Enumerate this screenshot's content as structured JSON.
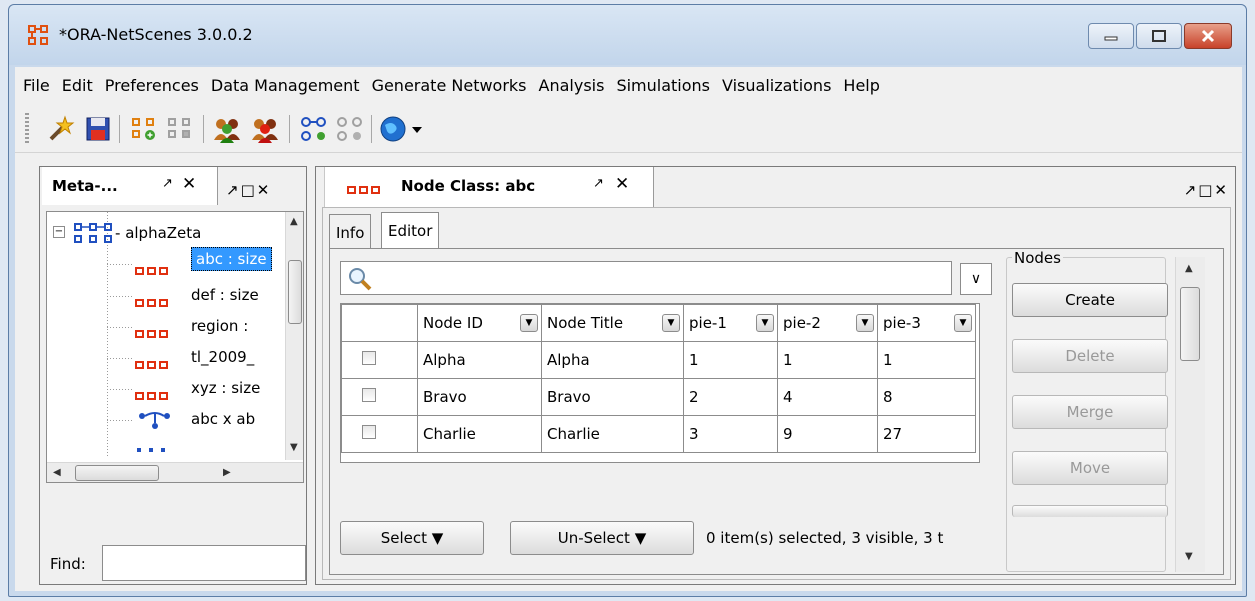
{
  "window": {
    "title": "*ORA-NetScenes 3.0.0.2",
    "controls": {
      "minimize": "minimize",
      "maximize": "maximize",
      "close": "close"
    }
  },
  "menu": {
    "items": [
      "File",
      "Edit",
      "Preferences",
      "Data Management",
      "Generate Networks",
      "Analysis",
      "Simulations",
      "Visualizations",
      "Help"
    ]
  },
  "toolbar": {
    "icons": [
      "wand-icon",
      "save-icon",
      "node-class-icon",
      "node-class-disabled-icon",
      "agents-icon",
      "agents-red-icon",
      "network-icon",
      "network-disabled-icon",
      "globe-icon"
    ]
  },
  "left_panel": {
    "tab_title": "Meta-...",
    "tree": {
      "root": "alphaZeta",
      "items": [
        {
          "label": "abc : size",
          "selected": true
        },
        {
          "label": "def : size"
        },
        {
          "label": "region : "
        },
        {
          "label": "tl_2009_"
        },
        {
          "label": "xyz : size"
        },
        {
          "label": "abc x ab"
        }
      ]
    },
    "find_label": "Find:",
    "find_value": ""
  },
  "right_panel": {
    "tab_title": "Node Class: abc",
    "sub_tabs": [
      "Info",
      "Editor"
    ],
    "active_sub_tab": "Editor",
    "search_value": "",
    "table": {
      "columns": [
        "Node ID",
        "Node Title",
        "pie-1",
        "pie-2",
        "pie-3"
      ],
      "rows": [
        [
          "Alpha",
          "Alpha",
          "1",
          "1",
          "1"
        ],
        [
          "Bravo",
          "Bravo",
          "2",
          "4",
          "8"
        ],
        [
          "Charlie",
          "Charlie",
          "3",
          "9",
          "27"
        ]
      ]
    },
    "select_label": "Select",
    "unselect_label": "Un-Select",
    "status": "0 item(s) selected, 3 visible, 3 t",
    "nodes_group": {
      "label": "Nodes",
      "buttons": [
        {
          "label": "Create",
          "enabled": true
        },
        {
          "label": "Delete",
          "enabled": false
        },
        {
          "label": "Merge",
          "enabled": false
        },
        {
          "label": "Move",
          "enabled": false
        }
      ]
    }
  },
  "colors": {
    "accent_selection": "#3399ff",
    "node_icon": "#e03010",
    "window_frame": "#c9d9ec",
    "close_button": "#c8422a"
  }
}
